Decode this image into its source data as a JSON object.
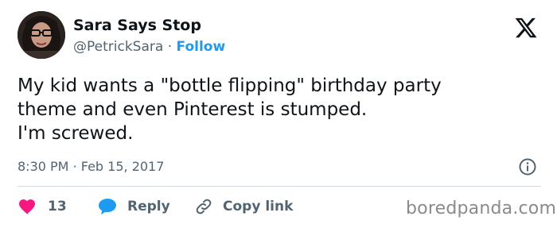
{
  "author": {
    "name": "Sara Says Stop",
    "handle": "@PetrickSara",
    "separator": "·",
    "follow_label": "Follow"
  },
  "tweet": {
    "lines": [
      "My kid wants a \"bottle flipping\" birthday party",
      "theme and even Pinterest is stumped.",
      "I'm screwed."
    ],
    "time": "8:30 PM",
    "date": "Feb 15, 2017",
    "time_separator": "·"
  },
  "actions": {
    "like_count": "13",
    "reply_label": "Reply",
    "copy_label": "Copy link"
  },
  "watermark": "boredpanda.com",
  "icons": {
    "platform": "x-logo-icon",
    "info": "info-icon",
    "like": "heart-icon",
    "reply": "speech-bubble-icon",
    "copy": "link-icon"
  },
  "colors": {
    "like": "#f91880",
    "reply": "#1d9bf0",
    "follow": "#1d9bf0",
    "muted": "#536471"
  }
}
